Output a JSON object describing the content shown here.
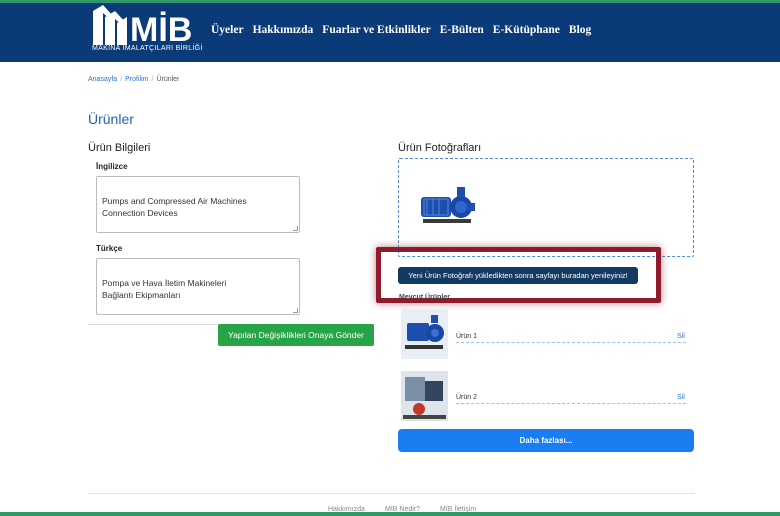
{
  "header": {
    "logo_text": "MİB",
    "logo_subtitle": "MAKİNA İMALATÇILARI BİRLİĞİ",
    "nav": [
      {
        "label": "Üyeler"
      },
      {
        "label": "Hakkımızda"
      },
      {
        "label": "Fuarlar ve Etkinlikler"
      },
      {
        "label": "E-Bülten"
      },
      {
        "label": "E-Kütüphane"
      },
      {
        "label": "Blog"
      }
    ]
  },
  "breadcrumb": {
    "home": "Anasayfa",
    "profile": "Profilim",
    "current": "Ürünler"
  },
  "page": {
    "title": "Ürünler"
  },
  "product_info": {
    "title": "Ürün Bilgileri",
    "english_label": "İngilizce",
    "english_value": "Pumps and Compressed Air Machines\nConnection Devices",
    "turkish_label": "Türkçe",
    "turkish_value": "Pompa ve Hava İletim Makineleri\nBağlantı Ekipmanları",
    "submit_label": "Yapılan Değişiklikleri Onaya Gönder"
  },
  "photos": {
    "title": "Ürün Fotoğrafları",
    "notice": "Yeni Ürün Fotoğrafı yükledikten sonra sayfayı buradan yenileyiniz!",
    "existing_label": "Mevcut Ürünler",
    "products": [
      {
        "name": "Ürün 1",
        "delete_label": "Sil"
      },
      {
        "name": "Ürün 2",
        "delete_label": "Sil"
      }
    ],
    "more_label": "Daha fazlası..."
  },
  "footer": {
    "links": [
      {
        "label": "Hakkımızda"
      },
      {
        "label": "MİB Nedir?"
      },
      {
        "label": "MİB İletişim"
      }
    ]
  },
  "colors": {
    "header_bg": "#0b3a78",
    "accent_green": "#27a348",
    "primary_blue": "#1a7df2",
    "highlight_border": "#8e1a2c"
  },
  "icons": {
    "pump": "pump-product-image",
    "logo": "mib-logo-icon"
  }
}
